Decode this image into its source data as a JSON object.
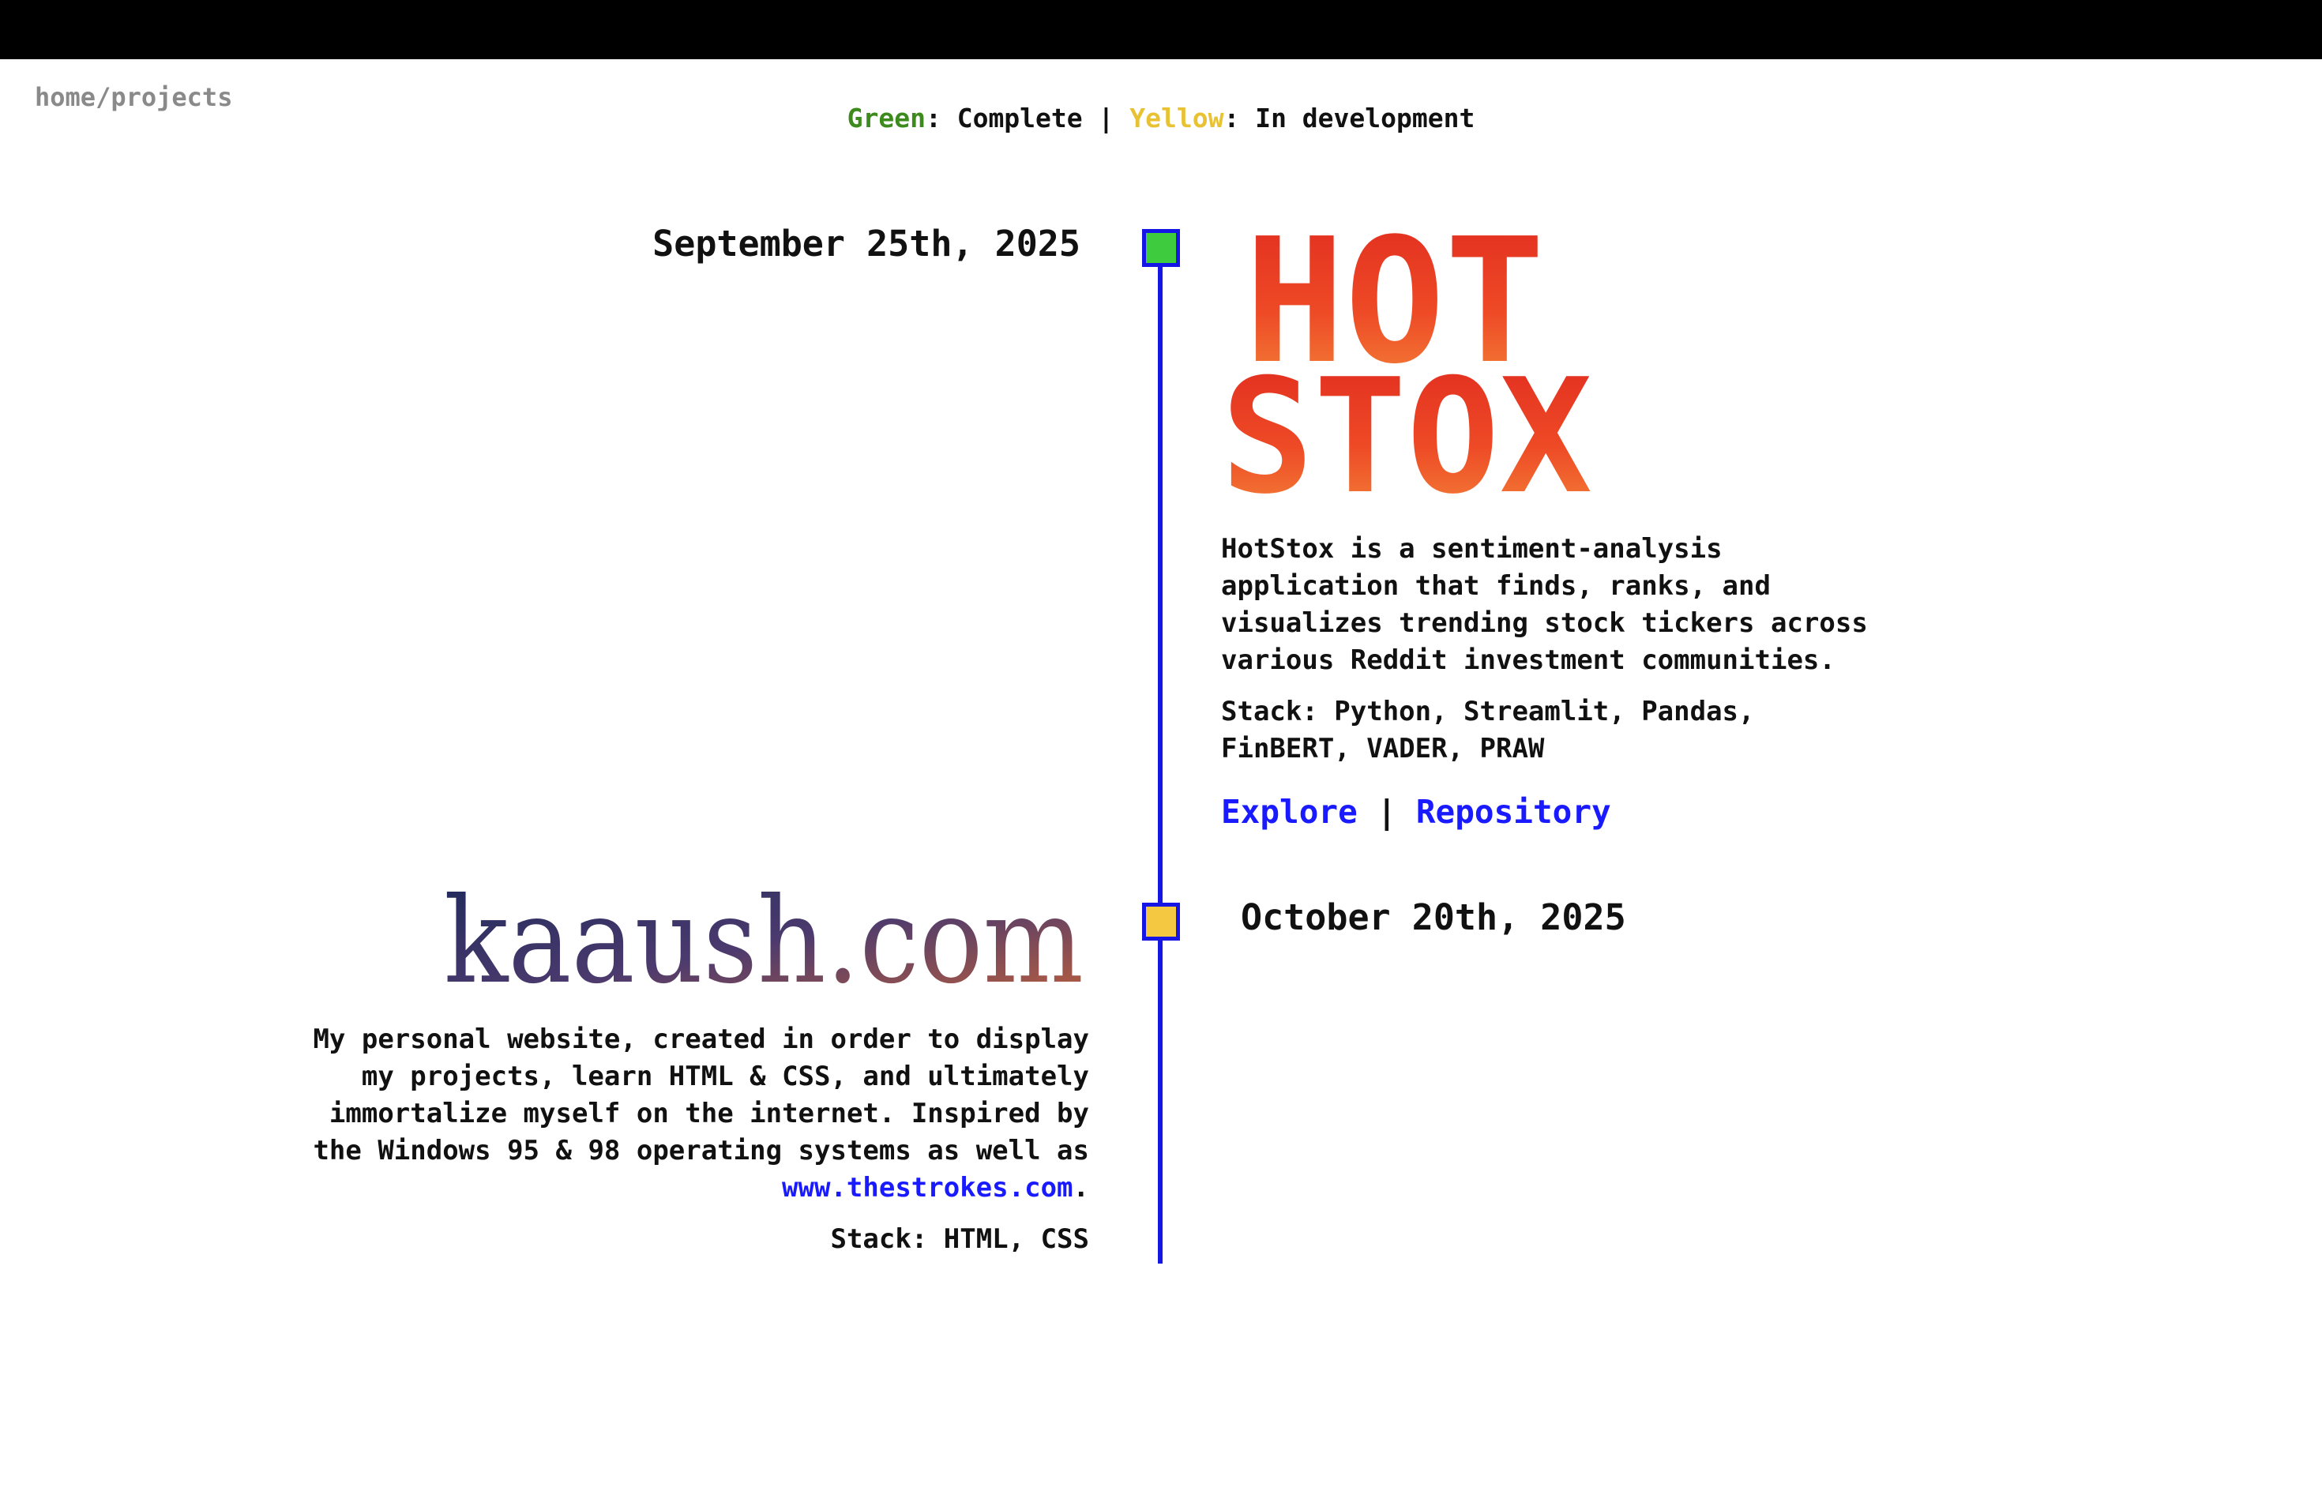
{
  "breadcrumb": "home/projects",
  "legend": {
    "green_word": "Green",
    "complete_text": ": Complete | ",
    "yellow_word": "Yellow",
    "development_text": ": In development"
  },
  "colors": {
    "complete": "#3ecb3e",
    "in_development": "#f5c842",
    "timeline": "#1515e6",
    "link": "#1a1aff"
  },
  "projects": [
    {
      "date": "September 25th, 2025",
      "status": "complete",
      "logo_text_line1": "HOT",
      "logo_text_line2": "STOX",
      "description": "HotStox is a sentiment-analysis application that finds, ranks, and visualizes trending stock tickers across various Reddit investment communities.",
      "stack": "Stack: Python, Streamlit, Pandas, FinBERT, VADER, PRAW",
      "explore_label": "Explore",
      "separator": " | ",
      "repository_label": "Repository"
    },
    {
      "date": "October 20th, 2025",
      "status": "in development",
      "logo_text": "kaaush.com",
      "description_before_link": "My personal website, created in order to display my projects, learn HTML & CSS, and ultimately immortalize myself on the internet. Inspired by the Windows 95 & 98 operating systems as well as ",
      "link_label": "www.thestrokes.com",
      "description_after_link": ".",
      "stack": "Stack: HTML, CSS"
    }
  ]
}
